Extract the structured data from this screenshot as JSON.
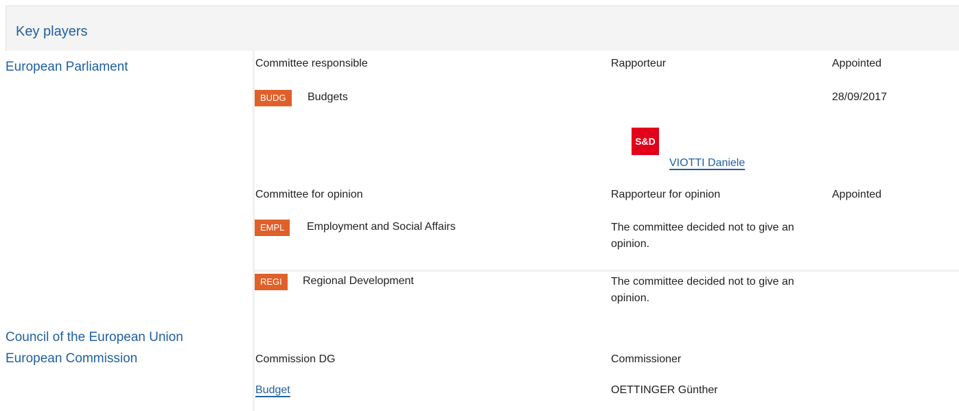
{
  "header": {
    "title": "Key players"
  },
  "orgs": {
    "ep": "European Parliament",
    "council": "Council of the European Union",
    "commission": "European Commission"
  },
  "responsible": {
    "col_committee": "Committee responsible",
    "col_rapporteur": "Rapporteur",
    "col_appointed": "Appointed",
    "badge": "BUDG",
    "committee": "Budgets",
    "appointed": "28/09/2017",
    "party_logo": "S&D",
    "rapporteur": "VIOTTI Daniele"
  },
  "opinion": {
    "col_committee": "Committee for opinion",
    "col_rapporteur": "Rapporteur for opinion",
    "col_appointed": "Appointed",
    "rows": [
      {
        "badge": "EMPL",
        "committee": "Employment and Social Affairs",
        "note": "The committee decided not to give an opinion."
      },
      {
        "badge": "REGI",
        "committee": "Regional Development",
        "note": "The committee decided not to give an opinion."
      }
    ]
  },
  "commission": {
    "col_dg": "Commission DG",
    "col_commissioner": "Commissioner",
    "dg": "Budget",
    "commissioner": "OETTINGER Günther"
  },
  "colors": {
    "link": "#1f5fa0",
    "badge": "#e0602a",
    "sd_logo": "#e3001b"
  }
}
